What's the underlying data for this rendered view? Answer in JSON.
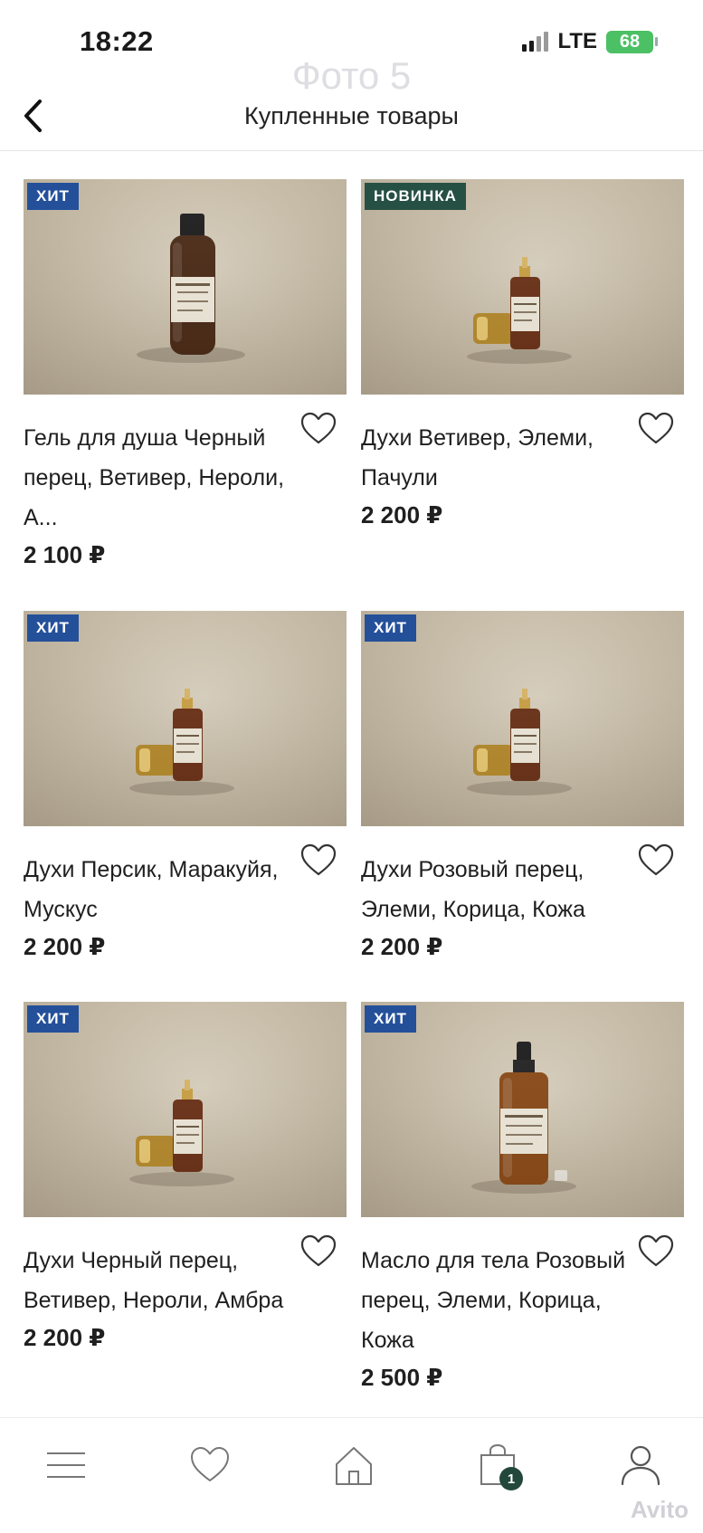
{
  "status_bar": {
    "time": "18:22",
    "network": "LTE",
    "battery": "68"
  },
  "watermark": {
    "photo_label": "Фото 5",
    "brand": "Avito"
  },
  "header": {
    "title": "Купленные товары",
    "back_icon": "chevron-left-icon"
  },
  "products": [
    {
      "badge": "ХИТ",
      "title": "Гель для душа Черный перец, Ветивер, Нероли, А...",
      "price": "2 100 ₽",
      "bottle": "shower-gel-bottle"
    },
    {
      "badge": "НОВИНКА",
      "title": "Духи Ветивер, Элеми, Пачули",
      "price": "2 200 ₽",
      "bottle": "perfume-bottle"
    },
    {
      "badge": "ХИТ",
      "title": "Духи Персик, Маракуйя, Мускус",
      "price": "2 200 ₽",
      "bottle": "perfume-bottle"
    },
    {
      "badge": "ХИТ",
      "title": "Духи Розовый перец, Элеми, Корица, Кожа",
      "price": "2 200 ₽",
      "bottle": "perfume-bottle"
    },
    {
      "badge": "ХИТ",
      "title": "Духи Черный перец, Ветивер, Нероли, Амбра",
      "price": "2 200 ₽",
      "bottle": "perfume-bottle"
    },
    {
      "badge": "ХИТ",
      "title": "Масло для тела Розовый перец, Элеми, Корица, Кожа",
      "price": "2 500 ₽",
      "bottle": "body-oil-bottle"
    }
  ],
  "bottom_nav": {
    "items": [
      "menu-icon",
      "heart-icon",
      "home-icon",
      "cart-icon",
      "profile-icon"
    ],
    "cart_count": "1"
  },
  "colors": {
    "badge_hit": "#24509a",
    "badge_new": "#275044",
    "cart_badge": "#24473c",
    "battery": "#4cc064"
  }
}
